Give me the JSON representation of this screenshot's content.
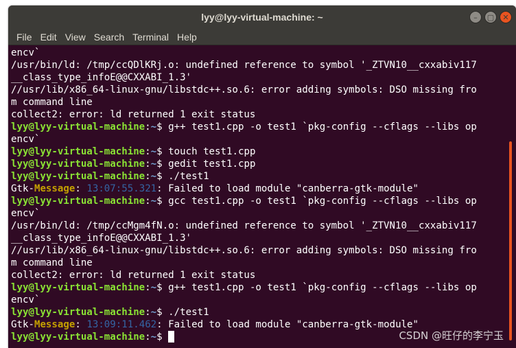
{
  "window": {
    "title": "lyy@lyy-virtual-machine: ~",
    "controls": {
      "minimize": "–",
      "maximize": "▢",
      "close": "✕"
    }
  },
  "menu": [
    "File",
    "Edit",
    "View",
    "Search",
    "Terminal",
    "Help"
  ],
  "terminal": {
    "lines": [
      "encv`",
      "/usr/bin/ld: /tmp/ccQDlKRj.o: undefined reference to symbol '_ZTVN10__cxxabiv117",
      "__class_type_infoE@@CXXABI_1.3'",
      "//usr/lib/x86_64-linux-gnu/libstdc++.so.6: error adding symbols: DSO missing fro",
      "m command line",
      "collect2: error: ld returned 1 exit status",
      {
        "user": "lyy@lyy-virtual-machine",
        "path": "~",
        "cmd": " g++ test1.cpp -o test1 `pkg-config --cflags --libs op"
      },
      "encv`",
      {
        "user": "lyy@lyy-virtual-machine",
        "path": "~",
        "cmd": " touch test1.cpp"
      },
      {
        "user": "lyy@lyy-virtual-machine",
        "path": "~",
        "cmd": " gedit test1.cpp"
      },
      {
        "user": "lyy@lyy-virtual-machine",
        "path": "~",
        "cmd": " ./test1"
      },
      {
        "gtk": "Gtk-",
        "msg": "Message",
        "time": "13:07:55.321",
        "text": ": Failed to load module \"canberra-gtk-module\""
      },
      {
        "user": "lyy@lyy-virtual-machine",
        "path": "~",
        "cmd": " gcc test1.cpp -o test1 `pkg-config --cflags --libs op"
      },
      "encv`",
      "/usr/bin/ld: /tmp/ccMgm4fN.o: undefined reference to symbol '_ZTVN10__cxxabiv117",
      "__class_type_infoE@@CXXABI_1.3'",
      "//usr/lib/x86_64-linux-gnu/libstdc++.so.6: error adding symbols: DSO missing fro",
      "m command line",
      "collect2: error: ld returned 1 exit status",
      {
        "user": "lyy@lyy-virtual-machine",
        "path": "~",
        "cmd": " g++ test1.cpp -o test1 `pkg-config --cflags --libs op"
      },
      "encv`",
      {
        "user": "lyy@lyy-virtual-machine",
        "path": "~",
        "cmd": " ./test1"
      },
      {
        "gtk": "Gtk-",
        "msg": "Message",
        "time": "13:09:11.462",
        "text": ": Failed to load module \"canberra-gtk-module\""
      },
      {
        "user": "lyy@lyy-virtual-machine",
        "path": "~",
        "cmd": " ",
        "cursor": true
      }
    ]
  },
  "watermark": "CSDN @旺仔的李宁玉",
  "colors": {
    "background": "#300a24",
    "prompt_user": "#8ae234",
    "prompt_path": "#729fcf",
    "accent": "#e95420"
  }
}
